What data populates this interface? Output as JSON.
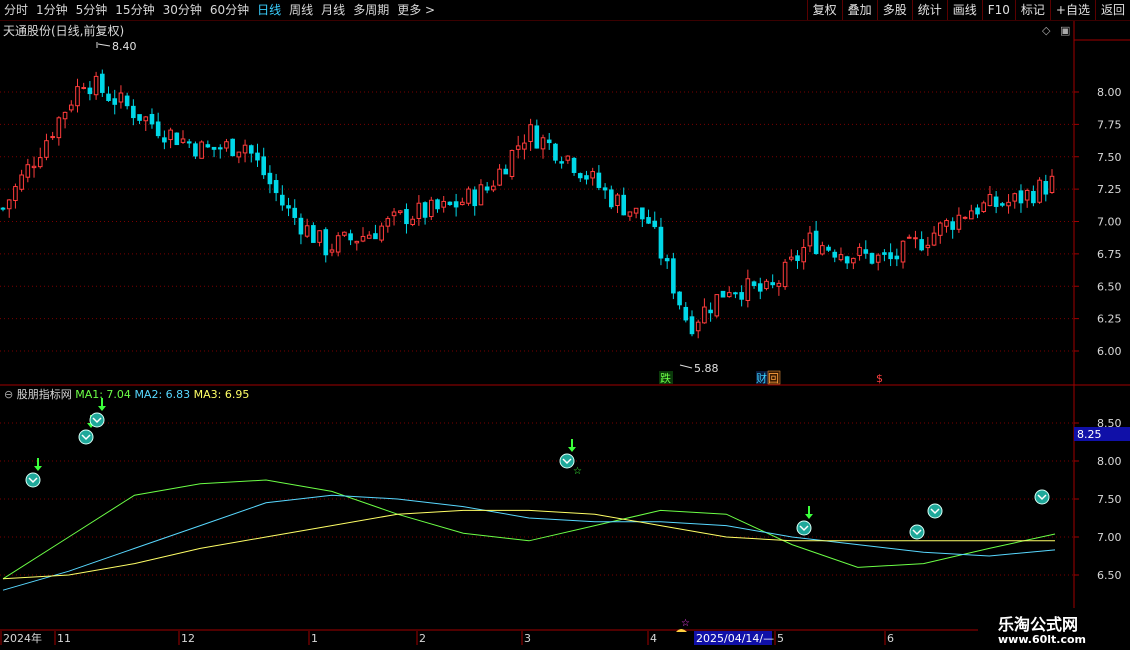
{
  "toolbar": {
    "periods": [
      "分时",
      "1分钟",
      "5分钟",
      "15分钟",
      "30分钟",
      "60分钟",
      "日线",
      "周线",
      "月线",
      "多周期",
      "更多 >"
    ],
    "active_period": "日线",
    "buttons": [
      "复权",
      "叠加",
      "多股",
      "统计",
      "画线",
      "F10",
      "标记",
      "+自选",
      "返回"
    ]
  },
  "main_chart": {
    "title": "天通股份(日线,前复权)",
    "high_label": "8.40",
    "low_label": "5.88",
    "price_ticks": [
      "8.00",
      "7.75",
      "7.50",
      "7.25",
      "7.00",
      "6.75",
      "6.50",
      "6.25",
      "6.00"
    ],
    "markers": [
      {
        "text": "跌",
        "color": "#6cff46",
        "bg": "#0a3a0a"
      },
      {
        "text": "财",
        "color": "#3ad0ff",
        "bg": "#0a1a3a"
      },
      {
        "text": "回",
        "color": "#ffa040",
        "bg": "#3a1a00"
      },
      {
        "text": "$",
        "color": "#ff4040",
        "bg": "#000000"
      }
    ]
  },
  "indicator": {
    "name": "股朋指标网",
    "ma1": "MA1: 7.04",
    "ma2": "MA2: 6.83",
    "ma3": "MA3: 6.95",
    "ticks": [
      "8.50",
      "8.00",
      "7.50",
      "7.00",
      "6.50"
    ],
    "current_value": "8.25"
  },
  "time_axis": {
    "labels": [
      "2024年",
      "11",
      "12",
      "1",
      "2",
      "3",
      "4",
      "5",
      "6"
    ],
    "cursor_date": "2025/04/14/—"
  },
  "watermark": {
    "line1": "乐淘公式网",
    "line2": "www.60lt.com"
  },
  "colors": {
    "up": "#ff3c3c",
    "down": "#00d8e8",
    "grid": "#7a0000",
    "ma1": "#6cff46",
    "ma2": "#58d8ff",
    "ma3": "#ffff66"
  },
  "chart_data": {
    "type": "candlestick",
    "ylim": [
      5.8,
      8.4
    ],
    "x": [
      "2024-10",
      "2024-11",
      "2024-12",
      "2025-01",
      "2025-02",
      "2025-03",
      "2025-04",
      "2025-05",
      "2025-06"
    ],
    "close_trend": [
      7.1,
      7.6,
      8.1,
      7.9,
      7.7,
      7.55,
      7.6,
      7.1,
      6.8,
      6.9,
      7.05,
      7.1,
      7.25,
      7.7,
      7.5,
      7.2,
      7.0,
      6.2,
      6.5,
      6.45,
      6.85,
      6.75,
      6.7,
      6.9,
      7.1,
      7.15,
      7.3
    ],
    "indicator_ylim": [
      6.2,
      8.7
    ],
    "ma1": [
      6.45,
      7.0,
      7.55,
      7.7,
      7.75,
      7.6,
      7.3,
      7.05,
      6.95,
      7.15,
      7.35,
      7.3,
      6.9,
      6.6,
      6.65,
      6.85,
      7.04
    ],
    "ma2": [
      6.3,
      6.55,
      6.85,
      7.15,
      7.45,
      7.55,
      7.5,
      7.4,
      7.25,
      7.2,
      7.2,
      7.15,
      7.0,
      6.9,
      6.8,
      6.75,
      6.83
    ],
    "ma3": [
      6.45,
      6.5,
      6.65,
      6.85,
      7.0,
      7.15,
      7.3,
      7.35,
      7.35,
      7.3,
      7.15,
      7.0,
      6.95,
      6.95,
      6.95,
      6.95,
      6.95
    ]
  }
}
